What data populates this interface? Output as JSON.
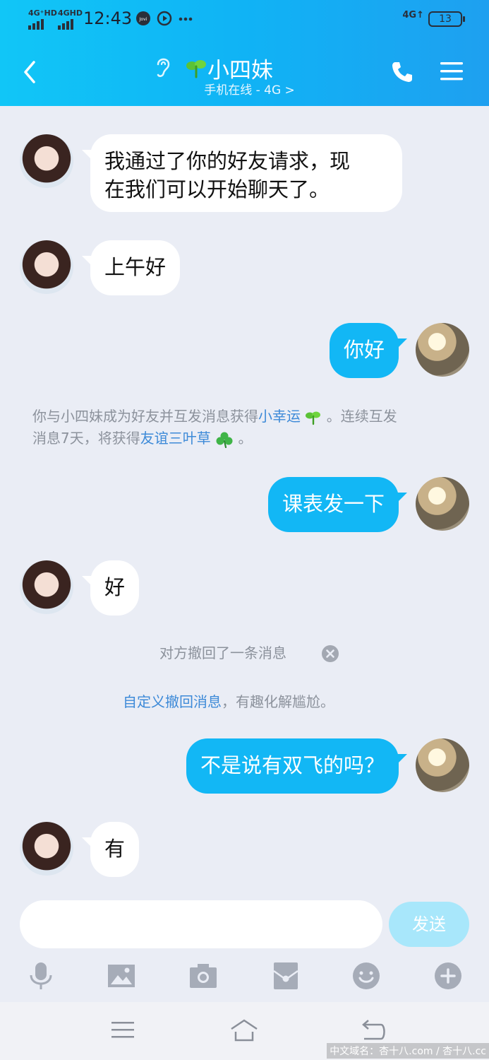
{
  "status_bar": {
    "sim1": "4G⁺HD",
    "sim2": "4GHD",
    "time": "12:43",
    "network_right": "4G↑",
    "battery": "13",
    "icons": [
      "jovi-icon",
      "play-icon",
      "more-dots-icon"
    ]
  },
  "header": {
    "contact_name": "小四妹",
    "subtitle": "手机在线 - 4G >",
    "icons": [
      "back-icon",
      "ear-icon",
      "sprout-icon",
      "phone-icon",
      "menu-icon"
    ]
  },
  "messages": [
    {
      "from": "contact",
      "text_lines": [
        "我通过了你的好友请求，现",
        "在我们可以开始聊天了。"
      ]
    },
    {
      "from": "contact",
      "text": "上午好"
    },
    {
      "from": "me",
      "text": "你好"
    },
    {
      "from": "me",
      "text": "课表发一下"
    },
    {
      "from": "contact",
      "text": "好"
    },
    {
      "from": "me",
      "text": "不是说有双飞的吗？"
    },
    {
      "from": "contact",
      "text": "有"
    }
  ],
  "system": {
    "friendship_line1_a": "你与小四妹成为好友并互发消息获得",
    "friendship_link1": "小幸运",
    "friendship_line1_b": "。连续互发",
    "friendship_line2_a": "消息7天，将获得",
    "friendship_link2": "友谊三叶草",
    "friendship_line2_b": "。",
    "recalled": "对方撤回了一条消息",
    "custom_link": "自定义撤回消息",
    "custom_rest": "，有趣化解尴尬。"
  },
  "composer": {
    "input_value": "",
    "send_label": "发送",
    "tools": [
      "microphone-icon",
      "image-icon",
      "camera-icon",
      "red-packet-icon",
      "emoji-icon",
      "plus-icon"
    ]
  },
  "nav": {
    "icons": [
      "menu-nav-icon",
      "home-nav-icon",
      "back-nav-icon"
    ]
  },
  "watermark": "中文域名：杏十八.com / 杏十八.cc",
  "colors": {
    "accent": "#12b7f5",
    "link": "#3d8ad8",
    "background": "#eaedf5"
  }
}
